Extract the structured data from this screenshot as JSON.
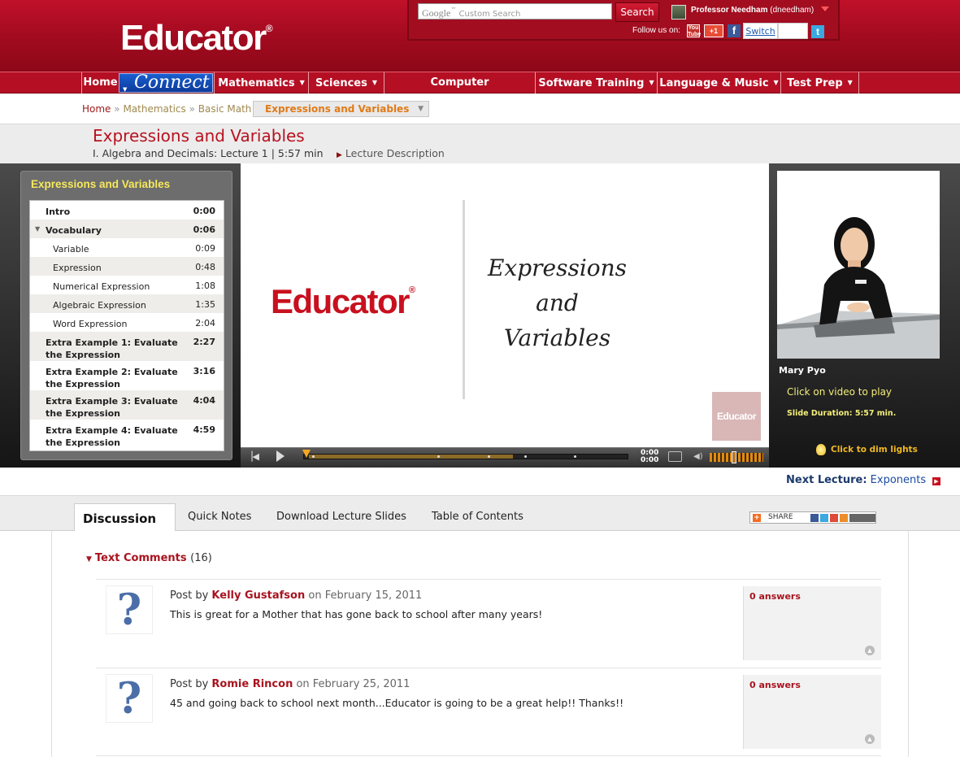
{
  "header": {
    "logo": "Educator",
    "logo_reg": "®",
    "search_placeholder_brand": "Google",
    "search_placeholder": "Custom Search",
    "search_button": "Search",
    "user_name": "Professor Needham",
    "user_handle": "(dneedham)",
    "follow_label": "Follow us on:",
    "youtube": "You Tube",
    "gplus": "+1",
    "facebook": "f",
    "switch_label": "Switch",
    "twitter": "t"
  },
  "nav": {
    "items": [
      {
        "label": "Home"
      },
      {
        "label": "Connect"
      },
      {
        "label": "Mathematics"
      },
      {
        "label": "Sciences"
      },
      {
        "label": "Computer Programming"
      },
      {
        "label": "Software Training"
      },
      {
        "label": "Language & Music"
      },
      {
        "label": "Test Prep"
      }
    ]
  },
  "breadcrumb": {
    "home": "Home",
    "sep": "»",
    "level1": "Mathematics",
    "level2": "Basic Math",
    "current": "Expressions and Variables"
  },
  "lecture": {
    "title": "Expressions and Variables",
    "subtitle": "I. Algebra and Decimals: Lecture 1 | 5:57 min",
    "description_link": "Lecture Description"
  },
  "toc": {
    "title": "Expressions and Variables",
    "rows": [
      {
        "label": "Intro",
        "time": "0:00"
      },
      {
        "label": "Vocabulary",
        "time": "0:06"
      },
      {
        "label": "Variable",
        "time": "0:09"
      },
      {
        "label": "Expression",
        "time": "0:48"
      },
      {
        "label": "Numerical Expression",
        "time": "1:08"
      },
      {
        "label": "Algebraic Expression",
        "time": "1:35"
      },
      {
        "label": "Word Expression",
        "time": "2:04"
      },
      {
        "label": "Extra Example 1: Evaluate the Expression",
        "time": "2:27"
      },
      {
        "label": "Extra Example 2: Evaluate the Expression",
        "time": "3:16"
      },
      {
        "label": "Extra Example 3: Evaluate the Expression",
        "time": "4:04"
      },
      {
        "label": "Extra Example 4: Evaluate the Expression",
        "time": "4:59"
      }
    ]
  },
  "slide": {
    "logo": "Educator",
    "logo_reg": "®",
    "line1": "Expressions",
    "line2": "and",
    "line3": "Variables",
    "watermark": "Educator"
  },
  "player": {
    "time_elapsed": "0:00",
    "time_total": "0:00",
    "progress_buffered": 0.65,
    "volume_level": 0.45
  },
  "instructor": {
    "name": "Mary Pyo",
    "click_play": "Click on video to play",
    "slide_duration": "Slide Duration: 5:57 min.",
    "dim_lights": "Click to dim lights"
  },
  "next_lecture": {
    "label": "Next Lecture:",
    "title": "Exponents"
  },
  "tabs": {
    "discussion": "Discussion",
    "quick_notes": "Quick Notes",
    "download_slides": "Download Lecture Slides",
    "table_of_contents": "Table of Contents",
    "share": "SHARE"
  },
  "comments": {
    "heading": "Text Comments",
    "count": "(16)",
    "posts": [
      {
        "prefix": "Post by",
        "author": "Kelly Gustafson",
        "date": "on February 15, 2011",
        "body": "This is great for a Mother that has gone back to school after many years!",
        "answers": "0 answers"
      },
      {
        "prefix": "Post by",
        "author": "Romie Rincon",
        "date": "on February 25, 2011",
        "body": "45 and going back to school next month...Educator is going to be a great help!! Thanks!!",
        "answers": "0 answers"
      }
    ]
  }
}
